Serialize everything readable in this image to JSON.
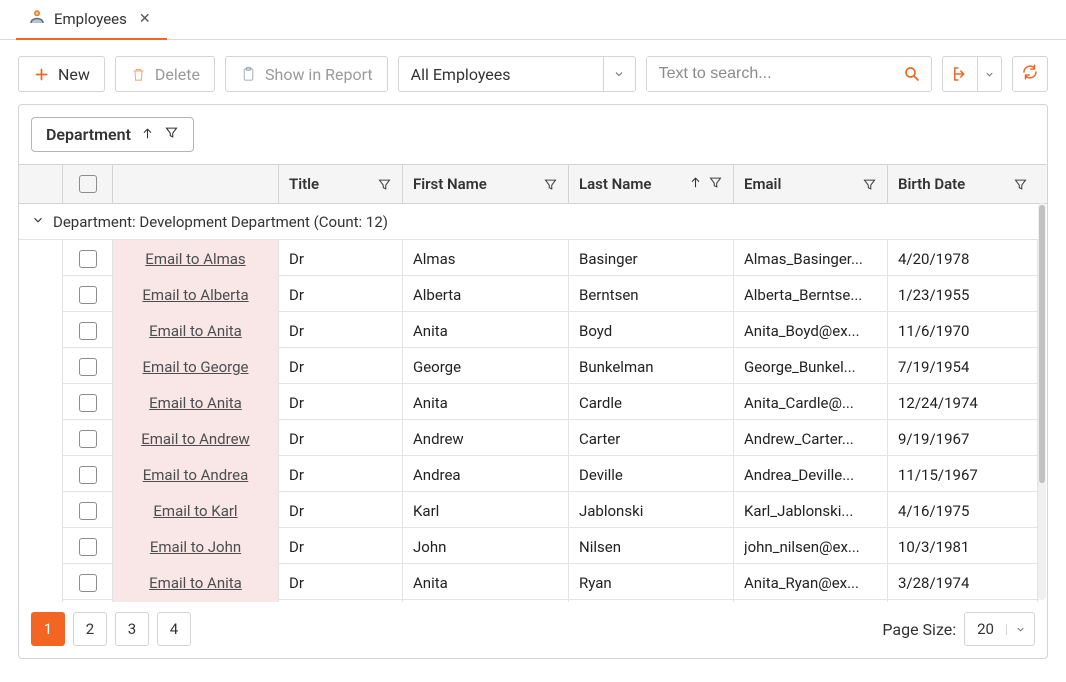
{
  "tab": {
    "title": "Employees"
  },
  "toolbar": {
    "new_label": "New",
    "delete_label": "Delete",
    "report_label": "Show in Report",
    "view_select": "All Employees",
    "search_placeholder": "Text to search..."
  },
  "group_chip": {
    "label": "Department"
  },
  "columns": {
    "title": "Title",
    "first_name": "First Name",
    "last_name": "Last Name",
    "email": "Email",
    "birth_date": "Birth Date"
  },
  "group_row": "Department: Development Department (Count: 12)",
  "rows": [
    {
      "link": "Email to Almas",
      "title": "Dr",
      "first": "Almas",
      "last": "Basinger",
      "email": "Almas_Basinger...",
      "birth": "4/20/1978"
    },
    {
      "link": "Email to Alberta",
      "title": "Dr",
      "first": "Alberta",
      "last": "Berntsen",
      "email": "Alberta_Berntse...",
      "birth": "1/23/1955"
    },
    {
      "link": "Email to Anita",
      "title": "Dr",
      "first": "Anita",
      "last": "Boyd",
      "email": "Anita_Boyd@ex...",
      "birth": "11/6/1970"
    },
    {
      "link": "Email to George",
      "title": "Dr",
      "first": "George",
      "last": "Bunkelman",
      "email": "George_Bunkel...",
      "birth": "7/19/1954"
    },
    {
      "link": "Email to Anita",
      "title": "Dr",
      "first": "Anita",
      "last": "Cardle",
      "email": "Anita_Cardle@...",
      "birth": "12/24/1974"
    },
    {
      "link": "Email to Andrew",
      "title": "Dr",
      "first": "Andrew",
      "last": "Carter",
      "email": "Andrew_Carter...",
      "birth": "9/19/1967"
    },
    {
      "link": "Email to Andrea",
      "title": "Dr",
      "first": "Andrea",
      "last": "Deville",
      "email": "Andrea_Deville...",
      "birth": "11/15/1967"
    },
    {
      "link": "Email to Karl",
      "title": "Dr",
      "first": "Karl",
      "last": "Jablonski",
      "email": "Karl_Jablonski...",
      "birth": "4/16/1975"
    },
    {
      "link": "Email to John",
      "title": "Dr",
      "first": "John",
      "last": "Nilsen",
      "email": "john_nilsen@ex...",
      "birth": "10/3/1981"
    },
    {
      "link": "Email to Anita",
      "title": "Dr",
      "first": "Anita",
      "last": "Ryan",
      "email": "Anita_Ryan@ex...",
      "birth": "3/28/1974"
    }
  ],
  "pager": {
    "pages": [
      "1",
      "2",
      "3",
      "4"
    ],
    "active_index": 0,
    "page_size_label": "Page Size:",
    "page_size_value": "20"
  }
}
